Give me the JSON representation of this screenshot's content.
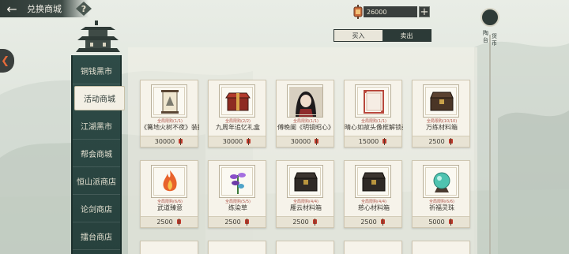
{
  "header": {
    "back_icon": "back-arrow-icon",
    "title": "兑换商城",
    "help_label": "?"
  },
  "currency": {
    "icon": "lantern-coin-icon",
    "value": "26000",
    "plus_label": "+"
  },
  "trade_toggle": {
    "buy_label": "买入",
    "sell_label": "卖出",
    "active": "buy"
  },
  "sidebar": {
    "items": [
      {
        "label": "铜钱黑市",
        "active": false
      },
      {
        "label": "活动商城",
        "active": true
      },
      {
        "label": "江湖黑市",
        "active": false
      },
      {
        "label": "帮会商城",
        "active": false
      },
      {
        "label": "恒山派商店",
        "active": false
      },
      {
        "label": "论剑商店",
        "active": false
      },
      {
        "label": "擂台商店",
        "active": false
      }
    ]
  },
  "rail": {
    "chars": [
      "陶",
      "台",
      "货",
      "币"
    ]
  },
  "items": [
    {
      "limit": "全局限购(1/1)",
      "name": "《篝地火树不夜》装扮",
      "price": "30000",
      "icon": "scroll-painting-icon"
    },
    {
      "limit": "全局限购(2/2)",
      "name": "九周年追忆礼盒",
      "price": "30000",
      "icon": "red-gift-box-icon"
    },
    {
      "limit": "全局限购(1/1)",
      "name": "傅晚阑《明镜昭心》",
      "price": "30000",
      "icon": "character-portrait-icon"
    },
    {
      "limit": "全局限购(1/1)",
      "name": "晴心如故头像框解锁券",
      "price": "15000",
      "icon": "avatar-frame-icon"
    },
    {
      "limit": "全局限购(10/10)",
      "name": "万练材料箱",
      "price": "2500",
      "icon": "material-chest-icon"
    },
    {
      "limit": "全局限购(6/6)",
      "name": "武道臻意",
      "price": "2500",
      "icon": "flame-icon"
    },
    {
      "limit": "全局限购(5/5)",
      "name": "练染草",
      "price": "2500",
      "icon": "purple-herb-icon"
    },
    {
      "limit": "全局限购(4/4)",
      "name": "雁云材料箱",
      "price": "2500",
      "icon": "material-chest-icon"
    },
    {
      "limit": "全局限购(4/4)",
      "name": "慈心材料箱",
      "price": "2500",
      "icon": "material-chest-icon"
    },
    {
      "limit": "全局限购(6/6)",
      "name": "祈福灵珠",
      "price": "5000",
      "icon": "jade-orb-icon"
    }
  ]
}
